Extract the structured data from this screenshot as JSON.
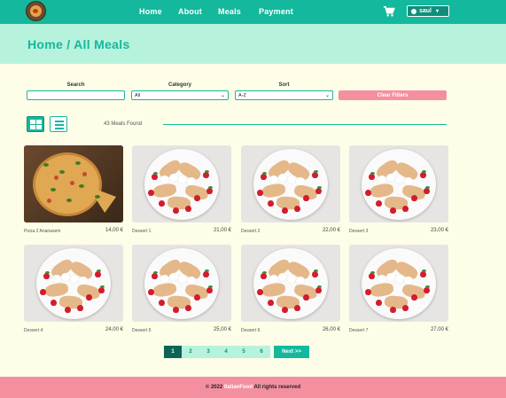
{
  "nav": {
    "links": [
      "Home",
      "About",
      "Meals",
      "Payment"
    ],
    "user_label": "saul"
  },
  "header": {
    "title": "Home / All Meals"
  },
  "filters": {
    "search_label": "Search",
    "search_value": "",
    "category_label": "Category",
    "category_value": "All",
    "sort_label": "Sort",
    "sort_value": "A-Z",
    "clear_label": "Clear Filters"
  },
  "results": {
    "count_text": "43 Meals Found"
  },
  "meals": [
    {
      "name": "Pizza 2 Ananasem",
      "price": "14,00 €",
      "image": "pizza"
    },
    {
      "name": "Dessert 1",
      "price": "21,00 €",
      "image": "dessert"
    },
    {
      "name": "Dessert 2",
      "price": "22,00 €",
      "image": "dessert"
    },
    {
      "name": "Dessert 3",
      "price": "23,00 €",
      "image": "dessert"
    },
    {
      "name": "Dessert 4",
      "price": "24,00 €",
      "image": "dessert"
    },
    {
      "name": "Dessert 5",
      "price": "25,00 €",
      "image": "dessert"
    },
    {
      "name": "Dessert 6",
      "price": "26,00 €",
      "image": "dessert"
    },
    {
      "name": "Dessert 7",
      "price": "27,00 €",
      "image": "dessert"
    }
  ],
  "pagination": {
    "pages": [
      "1",
      "2",
      "3",
      "4",
      "5",
      "6"
    ],
    "active_page": "1",
    "next_label": "Next >>"
  },
  "footer": {
    "prefix": "© 2022",
    "brand": "ItalianFood",
    "suffix": "All rights reserved"
  },
  "colors": {
    "primary": "#14b89c",
    "primary_dark": "#0d6655",
    "header_band": "#b6f2dc",
    "page_background": "#fefde8",
    "accent_pink": "#f48fa0"
  },
  "icons": [
    "logo",
    "cart-icon",
    "user-icon",
    "chevron-down-icon",
    "grid-view-icon",
    "list-view-icon"
  ]
}
